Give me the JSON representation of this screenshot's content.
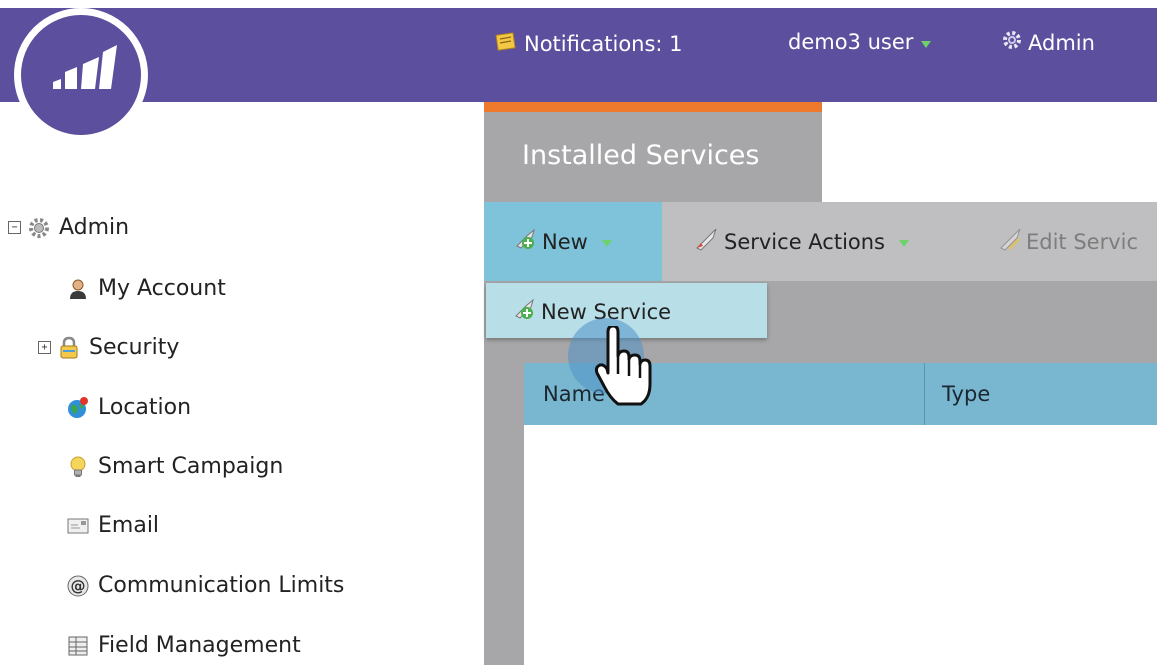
{
  "header": {
    "notifications_label": "Notifications: 1",
    "user_label": "demo3 user",
    "admin_label": "Admin"
  },
  "sidebar": {
    "items": [
      {
        "label": "Admin",
        "icon": "gear-icon"
      },
      {
        "label": "My Account",
        "icon": "user-icon"
      },
      {
        "label": "Security",
        "icon": "lock-icon"
      },
      {
        "label": "Location",
        "icon": "globe-icon"
      },
      {
        "label": "Smart Campaign",
        "icon": "lightbulb-icon"
      },
      {
        "label": "Email",
        "icon": "email-icon"
      },
      {
        "label": "Communication Limits",
        "icon": "at-sign-icon"
      },
      {
        "label": "Field Management",
        "icon": "table-icon"
      }
    ]
  },
  "main": {
    "tab_label": "Installed Services",
    "toolbar": {
      "new_label": "New",
      "service_actions_label": "Service Actions",
      "edit_service_label": "Edit Servic"
    },
    "dropdown": {
      "items": [
        "New Service"
      ]
    },
    "grid": {
      "columns": [
        "Name",
        "Type"
      ]
    }
  },
  "colors": {
    "header": "#5b4f9e",
    "accent_orange": "#ef7a2d",
    "toolbar_active": "#7ec3da",
    "grid_header": "#78b7cf"
  }
}
